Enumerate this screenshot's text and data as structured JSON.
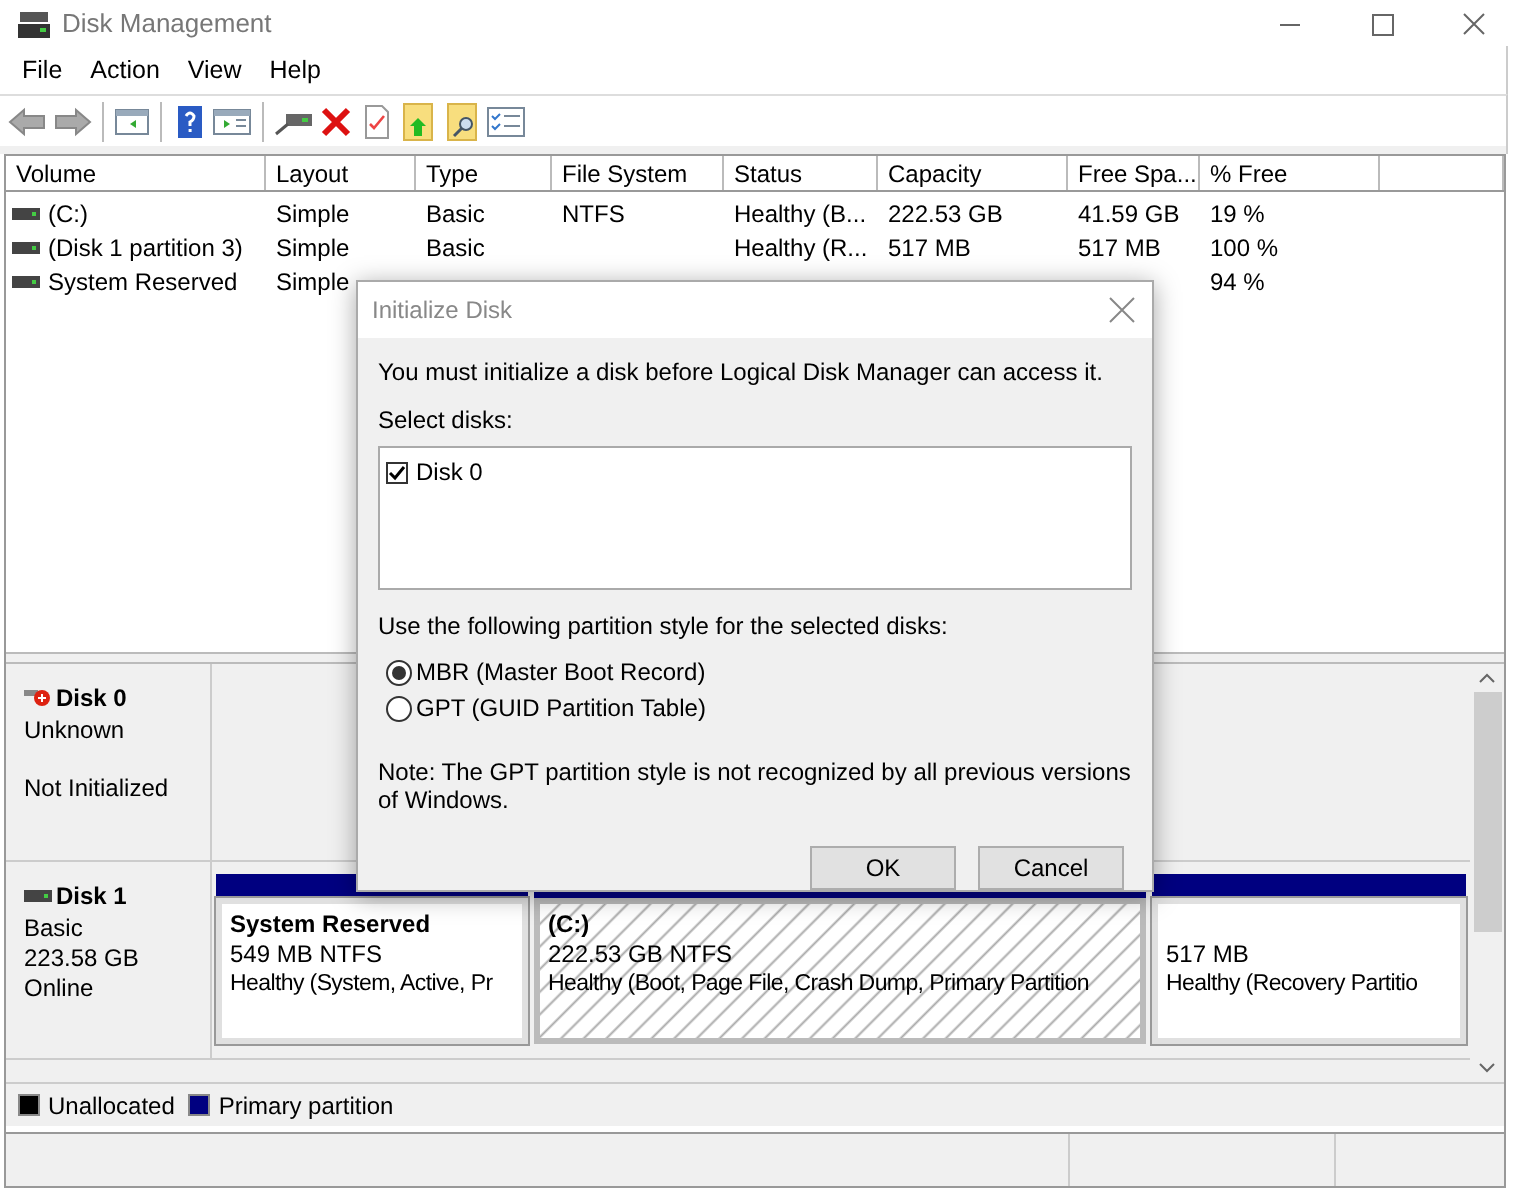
{
  "window": {
    "title": "Disk Management"
  },
  "menu": [
    "File",
    "Action",
    "View",
    "Help"
  ],
  "volume_table": {
    "columns": [
      "Volume",
      "Layout",
      "Type",
      "File System",
      "Status",
      "Capacity",
      "Free Spa...",
      "% Free"
    ],
    "rows": [
      [
        "(C:)",
        "Simple",
        "Basic",
        "NTFS",
        "Healthy (B...",
        "222.53 GB",
        "41.59 GB",
        "19 %"
      ],
      [
        "(Disk 1 partition 3)",
        "Simple",
        "Basic",
        null,
        "Healthy (R...",
        "517 MB",
        "517 MB",
        "100 %"
      ],
      [
        "System Reserved",
        "Simple",
        null,
        null,
        null,
        null,
        null,
        "94 %"
      ]
    ]
  },
  "disks": [
    {
      "name": "Disk 0",
      "kind": "uninitialized",
      "lines": [
        "Unknown",
        "Not Initialized"
      ]
    },
    {
      "name": "Disk 1",
      "kind": "online",
      "lines": [
        "Basic",
        "223.58 GB",
        "Online"
      ],
      "partitions": [
        {
          "name": "System Reserved",
          "size": "549 MB NTFS",
          "status": "Healthy (System, Active, Pr",
          "selected": false
        },
        {
          "name": "(C:)",
          "size": "222.53 GB NTFS",
          "status": "Healthy (Boot, Page File, Crash Dump, Primary Partition",
          "selected": true
        },
        {
          "size": "517 MB",
          "status": "Healthy (Recovery Partitio",
          "selected": false
        }
      ]
    }
  ],
  "legend": [
    {
      "label": "Unallocated",
      "color": "#000000"
    },
    {
      "label": "Primary partition",
      "color": "#000080"
    }
  ],
  "dialog": {
    "title": "Initialize Disk",
    "message": "You must initialize a disk before Logical Disk Manager can access it.",
    "select_label": "Select disks:",
    "disks": [
      {
        "label": "Disk 0",
        "checked": true
      }
    ],
    "style_label": "Use the following partition style for the selected disks:",
    "styles": [
      {
        "label": "MBR (Master Boot Record)",
        "selected": true
      },
      {
        "label": "GPT (GUID Partition Table)",
        "selected": false
      }
    ],
    "note": "Note: The GPT partition style is not recognized by all previous versions of Windows.",
    "buttons": [
      "OK",
      "Cancel"
    ]
  }
}
